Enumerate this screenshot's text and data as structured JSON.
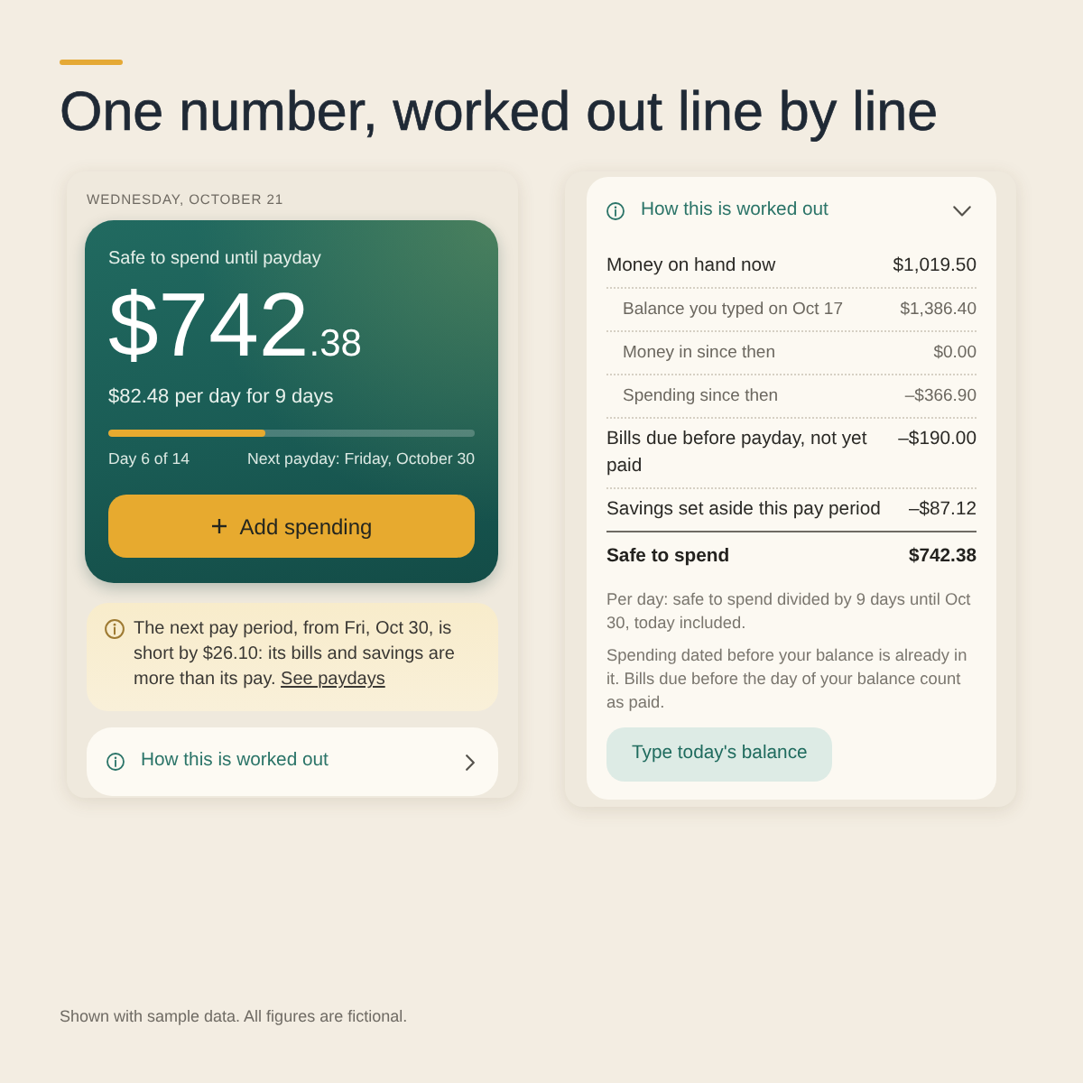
{
  "page": {
    "title": "One number, worked out line by line"
  },
  "today_screen": {
    "date": "WEDNESDAY, OCTOBER 21",
    "balance_card": {
      "label": "Safe to spend until payday",
      "amount": "$742",
      "cents": ".38",
      "per_day": "$82.48 per day for 9 days",
      "progress": {
        "level": 0.43
      },
      "day_label": "Day 6 of 14",
      "payday_label": "Next payday: Friday, October 30",
      "button": "Add spending"
    },
    "alert": {
      "text": "The next pay period, from Fri, Oct 30, is short by $26.10: its bills and savings are more than its pay.",
      "link": "See paydays"
    },
    "explainer": {
      "label": "How this is worked out",
      "expanded": false
    }
  },
  "breakdown_screen": {
    "header": {
      "label": "How this is worked out",
      "expanded": true
    },
    "rows": [
      {
        "kind": "main",
        "label": "Money on hand now",
        "amount": "$1,019.50"
      },
      {
        "kind": "sub",
        "label": "Balance you typed on Oct 17",
        "amount": "$1,386.40"
      },
      {
        "kind": "sub",
        "label": "Money in since then",
        "amount": "$0.00"
      },
      {
        "kind": "sub",
        "label": "Spending since then",
        "amount": "–$366.90"
      },
      {
        "kind": "main",
        "label": "Bills due before payday, not yet paid",
        "amount": "–$190.00"
      },
      {
        "kind": "main",
        "label": "Savings set aside this pay period",
        "amount": "–$87.12"
      },
      {
        "kind": "total",
        "label": "Safe to spend",
        "amount": "$742.38"
      }
    ],
    "notes": [
      "Per day: safe to spend divided by 9 days until Oct 30, today included.",
      "Spending dated before your balance is already in it. Bills due before the day of your balance count as paid."
    ],
    "button": "Type today's balance"
  },
  "footnote": "Shown with sample data. All figures are fictional."
}
